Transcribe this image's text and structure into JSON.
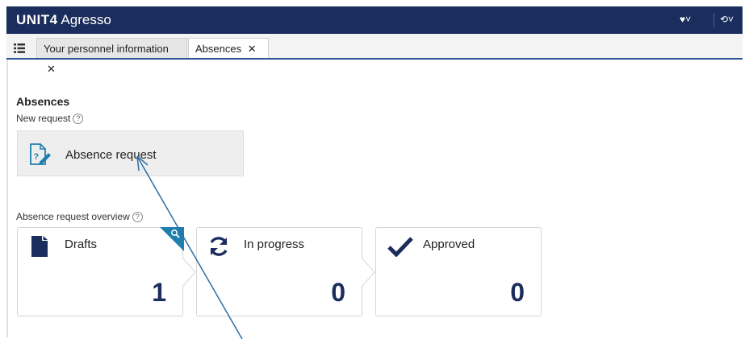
{
  "app": {
    "brand_bold": "UNIT4",
    "brand_rest": " Agresso",
    "favorites_label": "♥˅",
    "history_label": "⟲˅"
  },
  "tabs": [
    {
      "label": "Your personnel information",
      "close": "✕"
    },
    {
      "label": "Absences",
      "close": "✕"
    }
  ],
  "page": {
    "title": "Absences",
    "new_request_label": "New request",
    "overview_label": "Absence request overview",
    "help_glyph": "?"
  },
  "request_card": {
    "label": "Absence request",
    "icon": "document-help-edit-icon"
  },
  "overview_cards": [
    {
      "label": "Drafts",
      "count": "1",
      "icon": "document-icon"
    },
    {
      "label": "In progress",
      "count": "0",
      "icon": "refresh-icon"
    },
    {
      "label": "Approved",
      "count": "0",
      "icon": "checkmark-icon"
    }
  ],
  "colors": {
    "topbar": "#1b2d5c",
    "accent": "#1e7fae",
    "count": "#1b2d5c",
    "arrow": "#2e6da4"
  }
}
